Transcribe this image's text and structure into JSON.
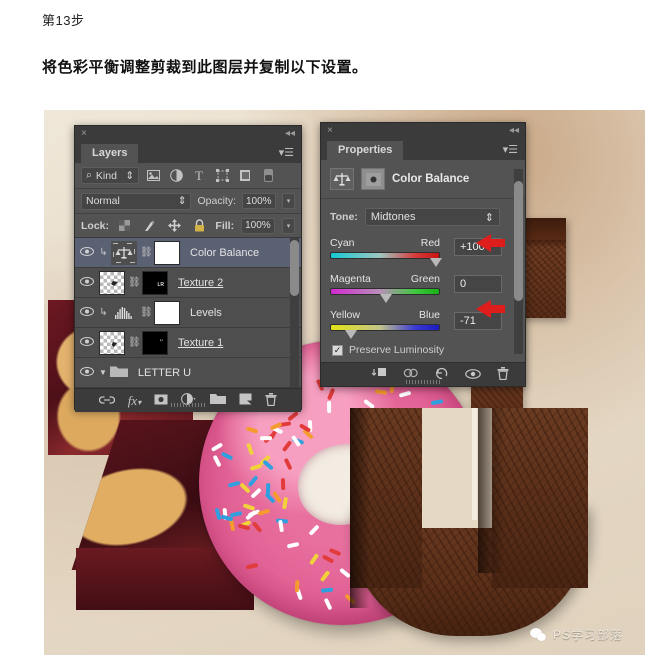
{
  "article": {
    "step_label": "第13步",
    "body_text": "将色彩平衡调整剪裁到此图层并复制以下设置。"
  },
  "layers_panel": {
    "close_icon": "×",
    "collapse_icon": "◂◂",
    "tab_label": "Layers",
    "menu_icon": "▾☰",
    "filter": {
      "search_icon": "⌕",
      "kind_label": "Kind",
      "stepper_icon": "⇕",
      "icons": [
        "image-filter-icon",
        "adjustment-filter-icon",
        "type-filter-icon",
        "shape-filter-icon",
        "smartobject-filter-icon",
        "filter-toggle-icon"
      ],
      "type_glyph": "T"
    },
    "blend_mode": "Normal",
    "opacity_label": "Opacity:",
    "opacity_value": "100%",
    "lock_label": "Lock:",
    "lock_icons": [
      "lock-transparency-icon",
      "lock-image-icon",
      "lock-position-icon",
      "lock-all-icon"
    ],
    "fill_label": "Fill:",
    "fill_value": "100%",
    "layers": [
      {
        "name": "Color Balance",
        "selected": true,
        "underline": false,
        "kind": "adjustment"
      },
      {
        "name": "Texture 2",
        "selected": false,
        "underline": true,
        "kind": "pixel"
      },
      {
        "name": "Levels",
        "selected": false,
        "underline": false,
        "kind": "adjustment"
      },
      {
        "name": "Texture 1",
        "selected": false,
        "underline": true,
        "kind": "pixel"
      },
      {
        "name": "LETTER U",
        "selected": false,
        "underline": false,
        "kind": "group"
      }
    ],
    "bottom_icons": [
      "link-layers-icon",
      "fx-icon",
      "add-mask-icon",
      "new-adjustment-icon",
      "new-group-icon",
      "new-layer-icon",
      "delete-layer-icon"
    ],
    "fx_glyph": "fx"
  },
  "properties_panel": {
    "close_icon": "×",
    "collapse_icon": "◂◂",
    "tab_label": "Properties",
    "menu_icon": "▾☰",
    "adjustment_title": "Color Balance",
    "tone_label": "Tone:",
    "tone_value": "Midtones",
    "sliders": [
      {
        "left_label": "Cyan",
        "right_label": "Red",
        "value": "+100",
        "knob_pct": 100,
        "highlighted": true
      },
      {
        "left_label": "Magenta",
        "right_label": "Green",
        "value": "0",
        "knob_pct": 50,
        "highlighted": false
      },
      {
        "left_label": "Yellow",
        "right_label": "Blue",
        "value": "-71",
        "knob_pct": 15,
        "highlighted": true
      }
    ],
    "preserve_luminosity_label": "Preserve Luminosity",
    "preserve_luminosity_checked": "✓",
    "bottom_icons": [
      "clip-to-layer-icon",
      "previous-state-icon",
      "reset-icon",
      "toggle-visibility-icon",
      "delete-adjustment-icon"
    ]
  },
  "watermark": {
    "text": "PS学习部落",
    "icon": "wechat-icon"
  },
  "colors": {
    "panel_bg": "#535353",
    "panel_header": "#3b3b3b",
    "selected_row": "#5a6173",
    "annotation_red": "#e01d1d",
    "photo_bg": "#e8dccb"
  }
}
